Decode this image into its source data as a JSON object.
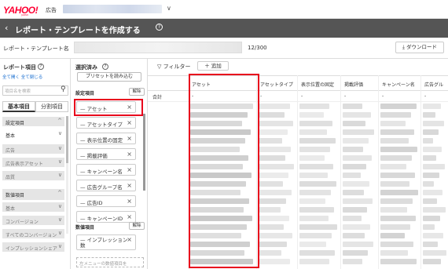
{
  "header": {
    "logo": "YAHOO!",
    "logo_sub": "広告",
    "logo_japan": "JAPAN",
    "account_chevron": "∨"
  },
  "titlebar": {
    "back": "‹",
    "title": "レポート・テンプレートを作成する",
    "help": "?"
  },
  "name_row": {
    "label": "レポート・テンプレート名",
    "counter": "12/300",
    "download_label": "ダウンロード",
    "download_icon": "⤓"
  },
  "report_items": {
    "title": "レポート項目",
    "expand_all": "全て開く",
    "collapse_all": "全て閉じる",
    "search_placeholder": "項目名を検索",
    "tabs": [
      "基本項目",
      "分割項目"
    ],
    "categories": [
      {
        "label": "設定項目",
        "style": "grey",
        "chev": "^"
      },
      {
        "label": "基本",
        "style": "plain",
        "chev": "∨"
      },
      {
        "label": "広告",
        "style": "grey sub",
        "chev": "∨"
      },
      {
        "label": "広告表示アセット",
        "style": "grey sub",
        "chev": "∨"
      },
      {
        "label": "品質",
        "style": "grey sub",
        "chev": "∨"
      },
      {
        "label": "数値項目",
        "style": "grey",
        "chev": "^"
      },
      {
        "label": "基本",
        "style": "grey sub",
        "chev": "∨"
      },
      {
        "label": "コンバージョン",
        "style": "grey sub",
        "chev": "∨"
      },
      {
        "label": "すべてのコンバージョン",
        "style": "grey sub",
        "chev": "∨"
      },
      {
        "label": "インプレッションシェア",
        "style": "grey sub",
        "chev": "∨"
      }
    ]
  },
  "selected": {
    "title": "選択済み",
    "help": "?",
    "preset_button": "プリセットを読み込む",
    "settings_section": "設定項目",
    "clear_label": "解除",
    "settings_items": [
      "アセット",
      "アセットタイプ",
      "表示位置の固定",
      "掲載評価",
      "キャンペーン名",
      "広告グループ名",
      "広告ID",
      "キャンペーンID"
    ],
    "numeric_section": "数値項目",
    "numeric_items": [
      "インプレッション数"
    ],
    "hint": "左メニューの数値項目を"
  },
  "table": {
    "filter_label": "フィルター",
    "filter_icon": "▽",
    "add_label": "＋ 追加",
    "columns": [
      "アセット",
      "アセットタイプ",
      "表示位置の固定",
      "掲載評価",
      "キャンペーン名",
      "広告グル"
    ],
    "total_row": [
      "合計",
      "-",
      "-",
      "-",
      "-",
      "-",
      "-"
    ]
  },
  "colors": {
    "brand_red": "#ff0033",
    "titlebar_bg": "#555555",
    "highlight": "#e8001c"
  }
}
